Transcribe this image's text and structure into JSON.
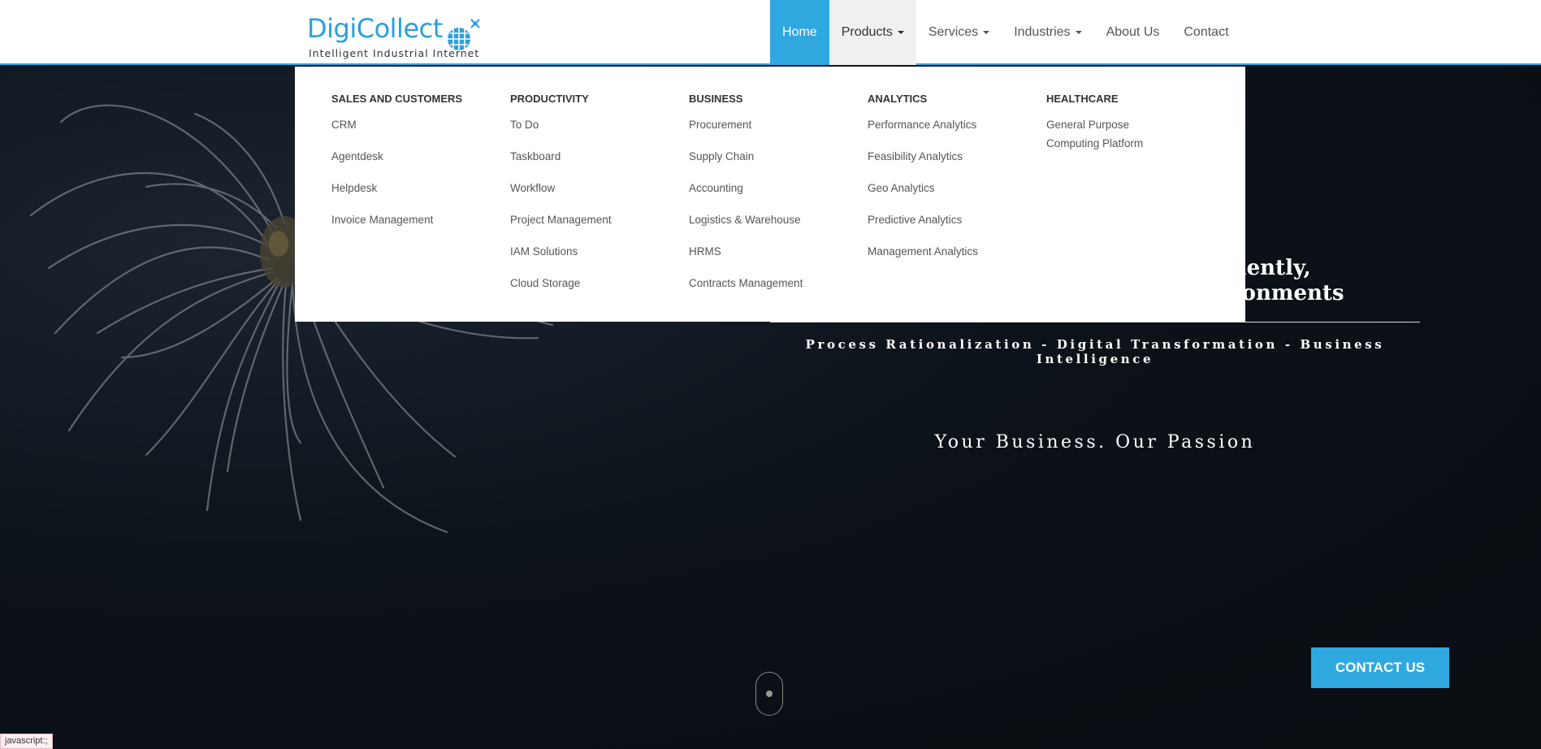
{
  "brand": {
    "name": "DigiCollect",
    "tagline": "Intelligent Industrial Internet",
    "color": "#2c9fdc"
  },
  "nav": {
    "items": [
      {
        "label": "Home",
        "state": "active",
        "dropdown": false
      },
      {
        "label": "Products",
        "state": "open",
        "dropdown": true
      },
      {
        "label": "Services",
        "state": "normal",
        "dropdown": true
      },
      {
        "label": "Industries",
        "state": "normal",
        "dropdown": true
      },
      {
        "label": "About Us",
        "state": "normal",
        "dropdown": false
      },
      {
        "label": "Contact",
        "state": "normal",
        "dropdown": false
      }
    ]
  },
  "products_menu": {
    "columns": [
      {
        "heading": "SALES AND CUSTOMERS",
        "links": [
          "CRM",
          "Agentdesk",
          "Helpdesk",
          "Invoice Management"
        ]
      },
      {
        "heading": "PRODUCTIVITY",
        "links": [
          "To Do",
          "Taskboard",
          "Workflow",
          "Project Management",
          "IAM Solutions",
          "Cloud Storage"
        ]
      },
      {
        "heading": "BUSINESS",
        "links": [
          "Procurement",
          "Supply Chain",
          "Accounting",
          "Logistics & Warehouse",
          "HRMS",
          "Contracts Management"
        ]
      },
      {
        "heading": "ANALYTICS",
        "links": [
          "Performance Analytics",
          "Feasibility Analytics",
          "Geo Analytics",
          "Predictive Analytics",
          "Management Analytics"
        ]
      },
      {
        "heading": "HEALTHCARE",
        "links": [
          "General Purpose Computing Platform"
        ]
      }
    ]
  },
  "hero": {
    "headline_line1": "uciently,",
    "headline_line2": "vironments",
    "subline": "Process Rationalization - Digital Transformation - Business Intelligence",
    "tagline": "Your Business. Our Passion"
  },
  "contact_button": {
    "label": "CONTACT US"
  },
  "status_bar": {
    "text": "javascript:;"
  },
  "colors": {
    "accent": "#2fa8e0",
    "hero_bg": "#0d1117"
  },
  "icons": {
    "logo": "globe-satellite-icon",
    "scroll": "scroll-mouse-icon"
  }
}
